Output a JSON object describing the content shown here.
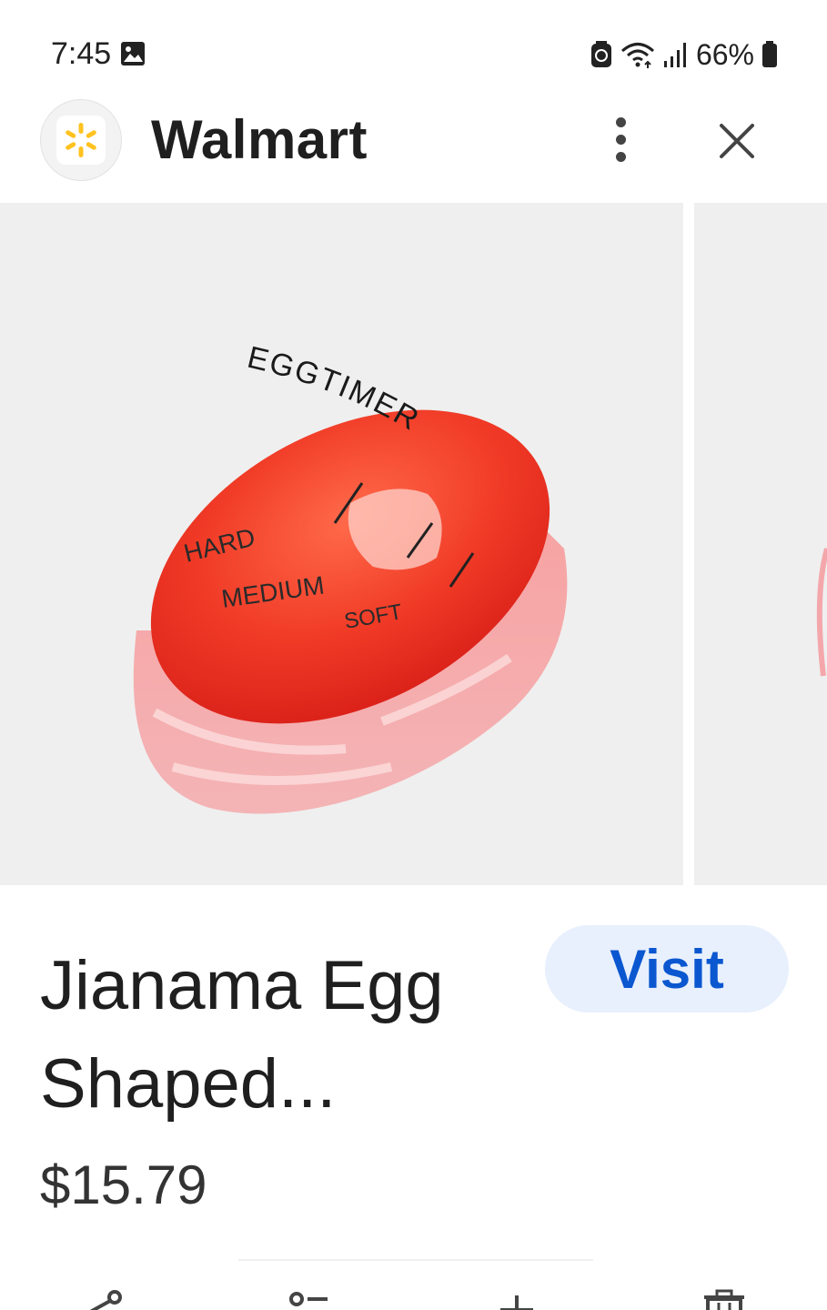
{
  "status_bar": {
    "time": "7:45",
    "battery": "66%",
    "icons": [
      "photo-icon",
      "battery-saver-icon",
      "wifi-icon",
      "signal-icon",
      "battery-icon"
    ]
  },
  "header": {
    "site_name": "Walmart",
    "logo_icon": "walmart-spark-icon",
    "more_icon": "more-vert-icon",
    "close_icon": "close-icon"
  },
  "product_image": {
    "egg_text_top": "EGGTIMER",
    "label_hard": "HARD",
    "label_medium": "MEDIUM",
    "label_soft": "SOFT"
  },
  "product": {
    "title_line1": "Jianama Egg",
    "title_line2": "Shaped...",
    "price": "$15.79",
    "visit_label": "Visit"
  },
  "toolbar": {
    "icons": [
      "share-icon",
      "add-to-list-icon",
      "add-icon",
      "delete-icon"
    ]
  },
  "colors": {
    "accent": "#0b57d0",
    "visit_bg": "#e8f0fd",
    "egg_red": "#e8321f",
    "walmart_yellow": "#ffc220"
  }
}
